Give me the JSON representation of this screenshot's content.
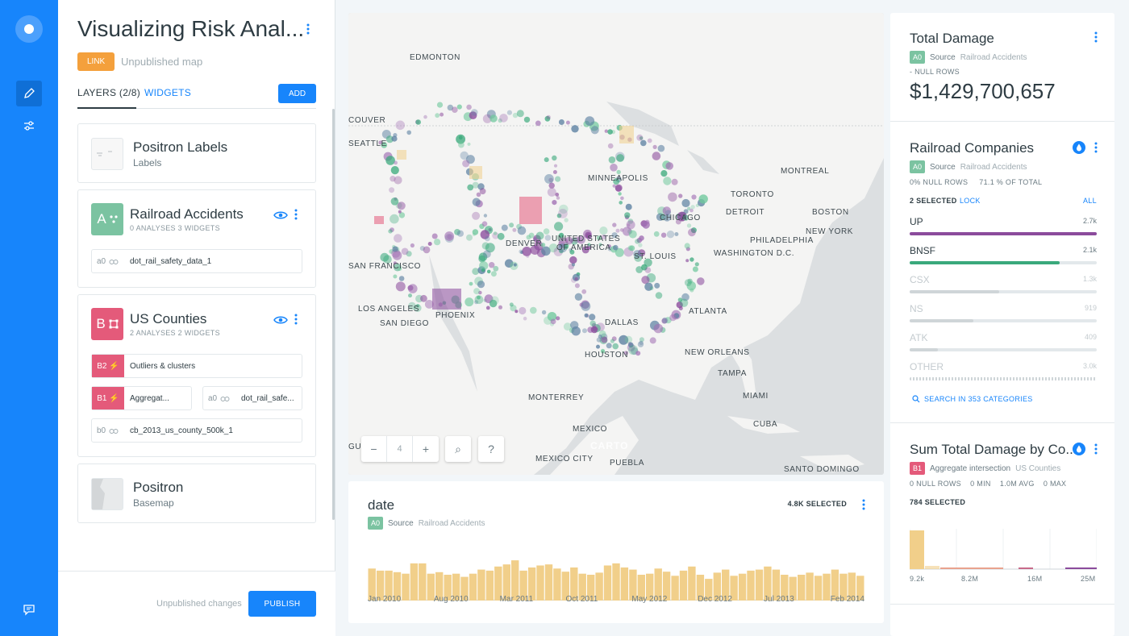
{
  "app": {
    "accent": "#1785fb"
  },
  "sidebar": {
    "icons": [
      "carto-logo-icon",
      "pencil-icon",
      "sliders-icon",
      "comment-icon"
    ]
  },
  "panel": {
    "title": "Visualizing Risk Anal...",
    "link_badge": "LINK",
    "status": "Unpublished map",
    "tabs": {
      "layers": "LAYERS (2/8)",
      "widgets": "WIDGETS"
    },
    "add_label": "ADD",
    "layers": [
      {
        "title": "Positron Labels",
        "subtitle": "Labels"
      },
      {
        "letter": "A",
        "title": "Railroad Accidents",
        "meta": "0 ANALYSES  3 WIDGETS",
        "source_id": "a0",
        "source_name": "dot_rail_safety_data_1"
      },
      {
        "letter": "B",
        "title": "US Counties",
        "meta": "2 ANALYSES  2 WIDGETS",
        "analyses": [
          {
            "id": "B2",
            "name": "Outliers & clusters"
          },
          {
            "id": "B1",
            "name": "Aggregat..."
          },
          {
            "id": "a0",
            "name": "dot_rail_safe..."
          },
          {
            "id": "b0",
            "name": "cb_2013_us_county_500k_1"
          }
        ]
      },
      {
        "title": "Positron",
        "subtitle": "Basemap"
      }
    ],
    "footer": {
      "unpublished": "Unpublished changes",
      "publish": "PUBLISH"
    }
  },
  "map": {
    "zoom": "4",
    "search_glyph": "⌕",
    "help_glyph": "?",
    "attribution": "CARTO",
    "cities": [
      "EDMONTON",
      "COUVER",
      "SEATTLE",
      "MINNEAPOLIS",
      "MONTREAL",
      "TORONTO",
      "DETROIT",
      "BOSTON",
      "CHICAGO",
      "NEW YORK",
      "PHILADELPHIA",
      "WASHINGTON D.C.",
      "DENVER",
      "UNITED STATES",
      "OF AMERICA",
      "ST. LOUIS",
      "SAN FRANCISCO",
      "LOS ANGELES",
      "SAN DIEGO",
      "PHOENIX",
      "ATLANTA",
      "DALLAS",
      "HOUSTON",
      "NEW ORLEANS",
      "TAMPA",
      "MIAMI",
      "MONTERREY",
      "MEXICO",
      "CUBA",
      "GUADALAJARA",
      "MEXICO CITY",
      "PUEBLA",
      "SANTO DOMINGO"
    ]
  },
  "timeseries": {
    "title": "date",
    "badge": "A0",
    "source_label": "Source",
    "source_name": "Railroad Accidents",
    "selected": "4.8K SELECTED",
    "bar_color": "#f1cf8a",
    "bars": [
      0.62,
      0.58,
      0.58,
      0.55,
      0.52,
      0.72,
      0.72,
      0.52,
      0.55,
      0.5,
      0.52,
      0.46,
      0.52,
      0.6,
      0.58,
      0.66,
      0.7,
      0.78,
      0.58,
      0.64,
      0.68,
      0.7,
      0.62,
      0.56,
      0.64,
      0.52,
      0.5,
      0.54,
      0.68,
      0.72,
      0.64,
      0.6,
      0.5,
      0.52,
      0.62,
      0.56,
      0.48,
      0.58,
      0.66,
      0.5,
      0.42,
      0.54,
      0.6,
      0.48,
      0.52,
      0.58,
      0.6,
      0.66,
      0.6,
      0.5,
      0.46,
      0.5,
      0.54,
      0.48,
      0.52,
      0.6,
      0.52,
      0.54,
      0.48
    ],
    "ticks": [
      "Jan 2010",
      "Aug 2010",
      "Mar 2011",
      "Oct 2011",
      "May 2012",
      "Dec 2012",
      "Jul 2013",
      "Feb 2014"
    ]
  },
  "widgets": {
    "total_damage": {
      "title": "Total Damage",
      "badge": "A0",
      "source_label": "Source",
      "source_name": "Railroad Accidents",
      "null_rows": "- NULL ROWS",
      "value": "$1,429,700,657"
    },
    "railroad": {
      "title": "Railroad Companies",
      "badge": "A0",
      "source_label": "Source",
      "source_name": "Railroad Accidents",
      "stats": "0% NULL ROWS     71.1 % OF TOTAL",
      "selected": "2 SELECTED",
      "lock": "LOCK",
      "all": "ALL",
      "categories": [
        {
          "name": "UP",
          "value": "2.7k",
          "fill": 1.0,
          "color": "#8b4b9c",
          "active": true
        },
        {
          "name": "BNSF",
          "value": "2.1k",
          "fill": 0.8,
          "color": "#3aa97c",
          "active": true
        },
        {
          "name": "CSX",
          "value": "1.3k",
          "fill": 0.48,
          "color": "#cfd5d8",
          "active": false
        },
        {
          "name": "NS",
          "value": "919",
          "fill": 0.34,
          "color": "#cfd5d8",
          "active": false
        },
        {
          "name": "ATK",
          "value": "409",
          "fill": 0.15,
          "color": "#cfd5d8",
          "active": false
        },
        {
          "name": "OTHER",
          "value": "3.0k",
          "fill": 1.0,
          "color": "#cfd5d8",
          "active": false
        }
      ],
      "search": "SEARCH IN 353 CATEGORIES"
    },
    "sum_damage": {
      "title": "Sum Total Damage by Co...",
      "badge": "B1",
      "source_label": "Aggregate intersection",
      "source_name": "US Counties",
      "stats": "0 NULL ROWS    0 MIN    1.0M AVG    0 MAX",
      "selected": "784 SELECTED",
      "ticks": [
        "9.2k",
        "8.2M",
        "16M",
        "25M"
      ]
    }
  }
}
